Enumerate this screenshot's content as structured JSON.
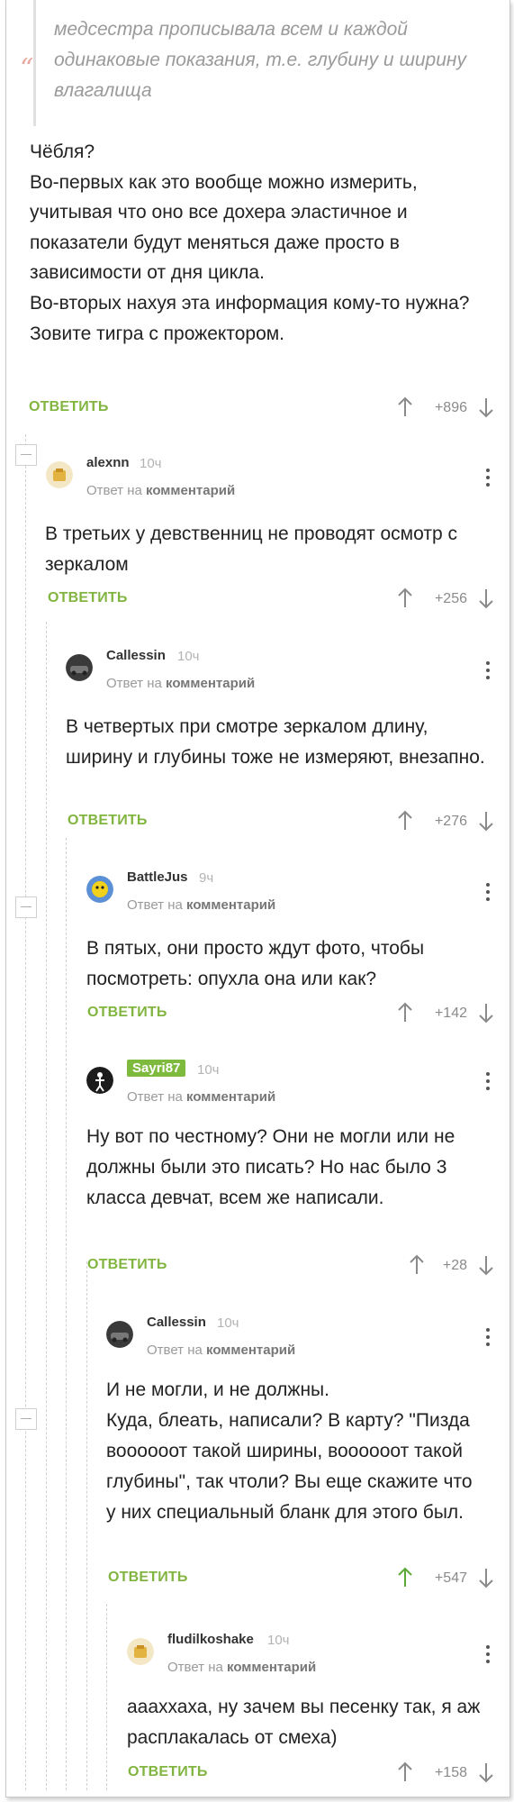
{
  "quote": {
    "text": "медсестра прописывала всем и каждой одинаковые показания, т.е. глубину и ширину влагалища"
  },
  "post": {
    "text": "Чёбля?\nВо-первых как это вообще можно измерить, учитывая что оно все дохера эластичное и показатели будут меняться даже просто в зависимости от дня цикла.\nВо-вторых нахуя эта информация кому-то нужна?\nЗовите тигра с прожектором.",
    "reply_label": "ОТВЕТИТЬ",
    "score": "+896"
  },
  "meta_prefix": "Ответ на",
  "meta_link": "комментарий",
  "comments": [
    {
      "author": "alexnn",
      "time": "10ч",
      "text": "В третьих у девственниц не проводят осмотр с зеркалом",
      "reply_label": "ОТВЕТИТЬ",
      "score": "+256"
    },
    {
      "author": "Callessin",
      "time": "10ч",
      "text": "В четвертых при смотре зеркалом длину, ширину и глубины тоже не измеряют, внезапно.",
      "reply_label": "ОТВЕТИТЬ",
      "score": "+276"
    },
    {
      "author": "BattleJus",
      "time": "9ч",
      "text": "В пятых, они просто ждут фото, чтобы посмотреть: опухла она или как?",
      "reply_label": "ОТВЕТИТЬ",
      "score": "+142"
    },
    {
      "author": "Sayri87",
      "time": "10ч",
      "text": "Ну вот по честному? Они не могли или не должны были это писать? Но нас было 3 класса девчат, всем же написали.",
      "reply_label": "ОТВЕТИТЬ",
      "score": "+28"
    },
    {
      "author": "Callessin",
      "time": "10ч",
      "text": "И не могли, и не должны.\nКуда, блеать, написали? В карту? \"Пизда вооооoот такой ширины, вооооoот такой глубины\", так чтоли? Вы еще скажите что у них специальный бланк для этого был.",
      "reply_label": "ОТВЕТИТЬ",
      "score": "+547"
    },
    {
      "author": "fludilkoshake",
      "time": "10ч",
      "text": "аааххаха, ну зачем вы песенку так, я аж расплакалась от смеха)",
      "reply_label": "ОТВЕТИТЬ",
      "score": "+158"
    }
  ],
  "colors": {
    "accent_green": "#82b540",
    "up_arrow_active": "#5aa937",
    "arrow_gray": "#8a8a8a"
  },
  "icons": {
    "up": "arrow-up-icon",
    "down": "arrow-down-icon",
    "more": "more-vertical-icon",
    "collapse": "collapse-thread-icon"
  }
}
